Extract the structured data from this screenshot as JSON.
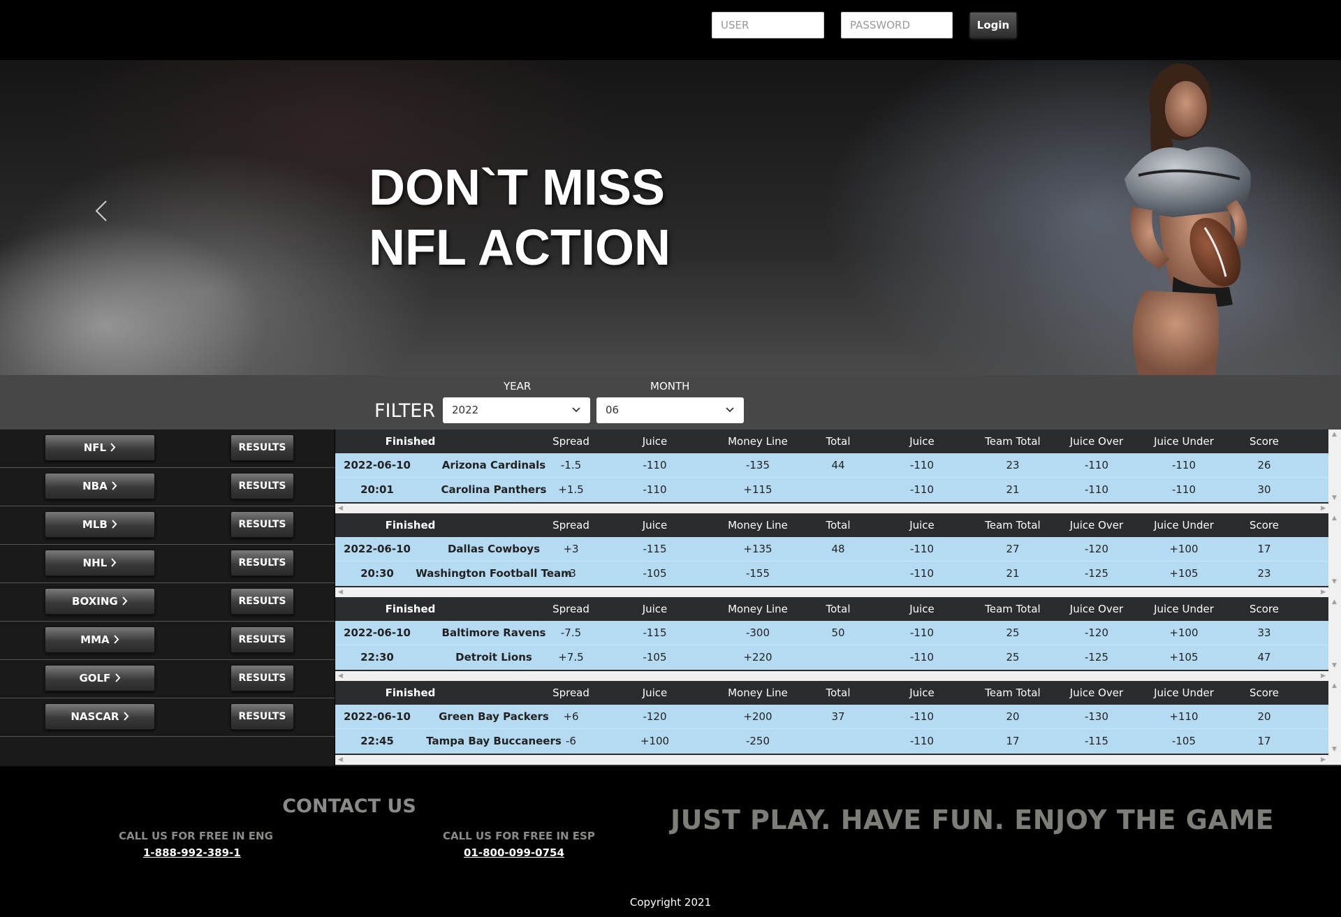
{
  "header": {
    "user_placeholder": "USER",
    "password_placeholder": "PASSWORD",
    "login_label": "Login"
  },
  "hero": {
    "title_line1": "DON`T MISS",
    "title_line2": "NFL ACTION",
    "prev_icon": "chevron-left-icon"
  },
  "filter": {
    "label": "FILTER",
    "year_caption": "YEAR",
    "year_value": "2022",
    "month_caption": "MONTH",
    "month_value": "06"
  },
  "sidebar": {
    "sports": [
      {
        "label": "NFL",
        "results_label": "RESULTS"
      },
      {
        "label": "NBA",
        "results_label": "RESULTS"
      },
      {
        "label": "MLB",
        "results_label": "RESULTS"
      },
      {
        "label": "NHL",
        "results_label": "RESULTS"
      },
      {
        "label": "BOXING",
        "results_label": "RESULTS"
      },
      {
        "label": "MMA",
        "results_label": "RESULTS"
      },
      {
        "label": "GOLF",
        "results_label": "RESULTS"
      },
      {
        "label": "NASCAR",
        "results_label": "RESULTS"
      }
    ]
  },
  "columns": [
    "Finished",
    "Spread",
    "Juice",
    "Money Line",
    "Total",
    "Juice",
    "Team Total",
    "Juice Over",
    "Juice Under",
    "Score"
  ],
  "games": [
    {
      "date": "2022-06-10",
      "time": "20:01",
      "teams": [
        {
          "name": "Arizona Cardinals",
          "spread": "-1.5",
          "juice": "-110",
          "money_line": "-135",
          "total": "44",
          "total_juice": "-110",
          "team_total": "23",
          "juice_over": "-110",
          "juice_under": "-110",
          "score": "26"
        },
        {
          "name": "Carolina Panthers",
          "spread": "+1.5",
          "juice": "-110",
          "money_line": "+115",
          "total": "",
          "total_juice": "-110",
          "team_total": "21",
          "juice_over": "-110",
          "juice_under": "-110",
          "score": "30"
        }
      ]
    },
    {
      "date": "2022-06-10",
      "time": "20:30",
      "teams": [
        {
          "name": "Dallas Cowboys",
          "spread": "+3",
          "juice": "-115",
          "money_line": "+135",
          "total": "48",
          "total_juice": "-110",
          "team_total": "27",
          "juice_over": "-120",
          "juice_under": "+100",
          "score": "17"
        },
        {
          "name": "Washington Football Team",
          "spread": "-3",
          "juice": "-105",
          "money_line": "-155",
          "total": "",
          "total_juice": "-110",
          "team_total": "21",
          "juice_over": "-125",
          "juice_under": "+105",
          "score": "23"
        }
      ]
    },
    {
      "date": "2022-06-10",
      "time": "22:30",
      "teams": [
        {
          "name": "Baltimore Ravens",
          "spread": "-7.5",
          "juice": "-115",
          "money_line": "-300",
          "total": "50",
          "total_juice": "-110",
          "team_total": "25",
          "juice_over": "-120",
          "juice_under": "+100",
          "score": "33"
        },
        {
          "name": "Detroit Lions",
          "spread": "+7.5",
          "juice": "-105",
          "money_line": "+220",
          "total": "",
          "total_juice": "-110",
          "team_total": "25",
          "juice_over": "-125",
          "juice_under": "+105",
          "score": "47"
        }
      ]
    },
    {
      "date": "2022-06-10",
      "time": "22:45",
      "teams": [
        {
          "name": "Green Bay Packers",
          "spread": "+6",
          "juice": "-120",
          "money_line": "+200",
          "total": "37",
          "total_juice": "-110",
          "team_total": "20",
          "juice_over": "-130",
          "juice_under": "+110",
          "score": "20"
        },
        {
          "name": "Tampa Bay Buccaneers",
          "spread": "-6",
          "juice": "+100",
          "money_line": "-250",
          "total": "",
          "total_juice": "-110",
          "team_total": "17",
          "juice_over": "-115",
          "juice_under": "-105",
          "score": "17"
        }
      ]
    }
  ],
  "footer": {
    "contact_title": "CONTACT US",
    "eng_label": "CALL US FOR FREE IN ENG",
    "eng_phone": "1-888-992-389-1",
    "esp_label": "CALL US FOR FREE IN ESP",
    "esp_phone": "01-800-099-0754",
    "tagline": "JUST PLAY. HAVE FUN. ENJOY THE GAME",
    "copyright": "Copyright 2021"
  },
  "colors": {
    "row_bg": "#b5dbf3",
    "header_bg": "#2b2c30",
    "filter_bg": "#474747",
    "footer_text": "#8a8a86"
  }
}
